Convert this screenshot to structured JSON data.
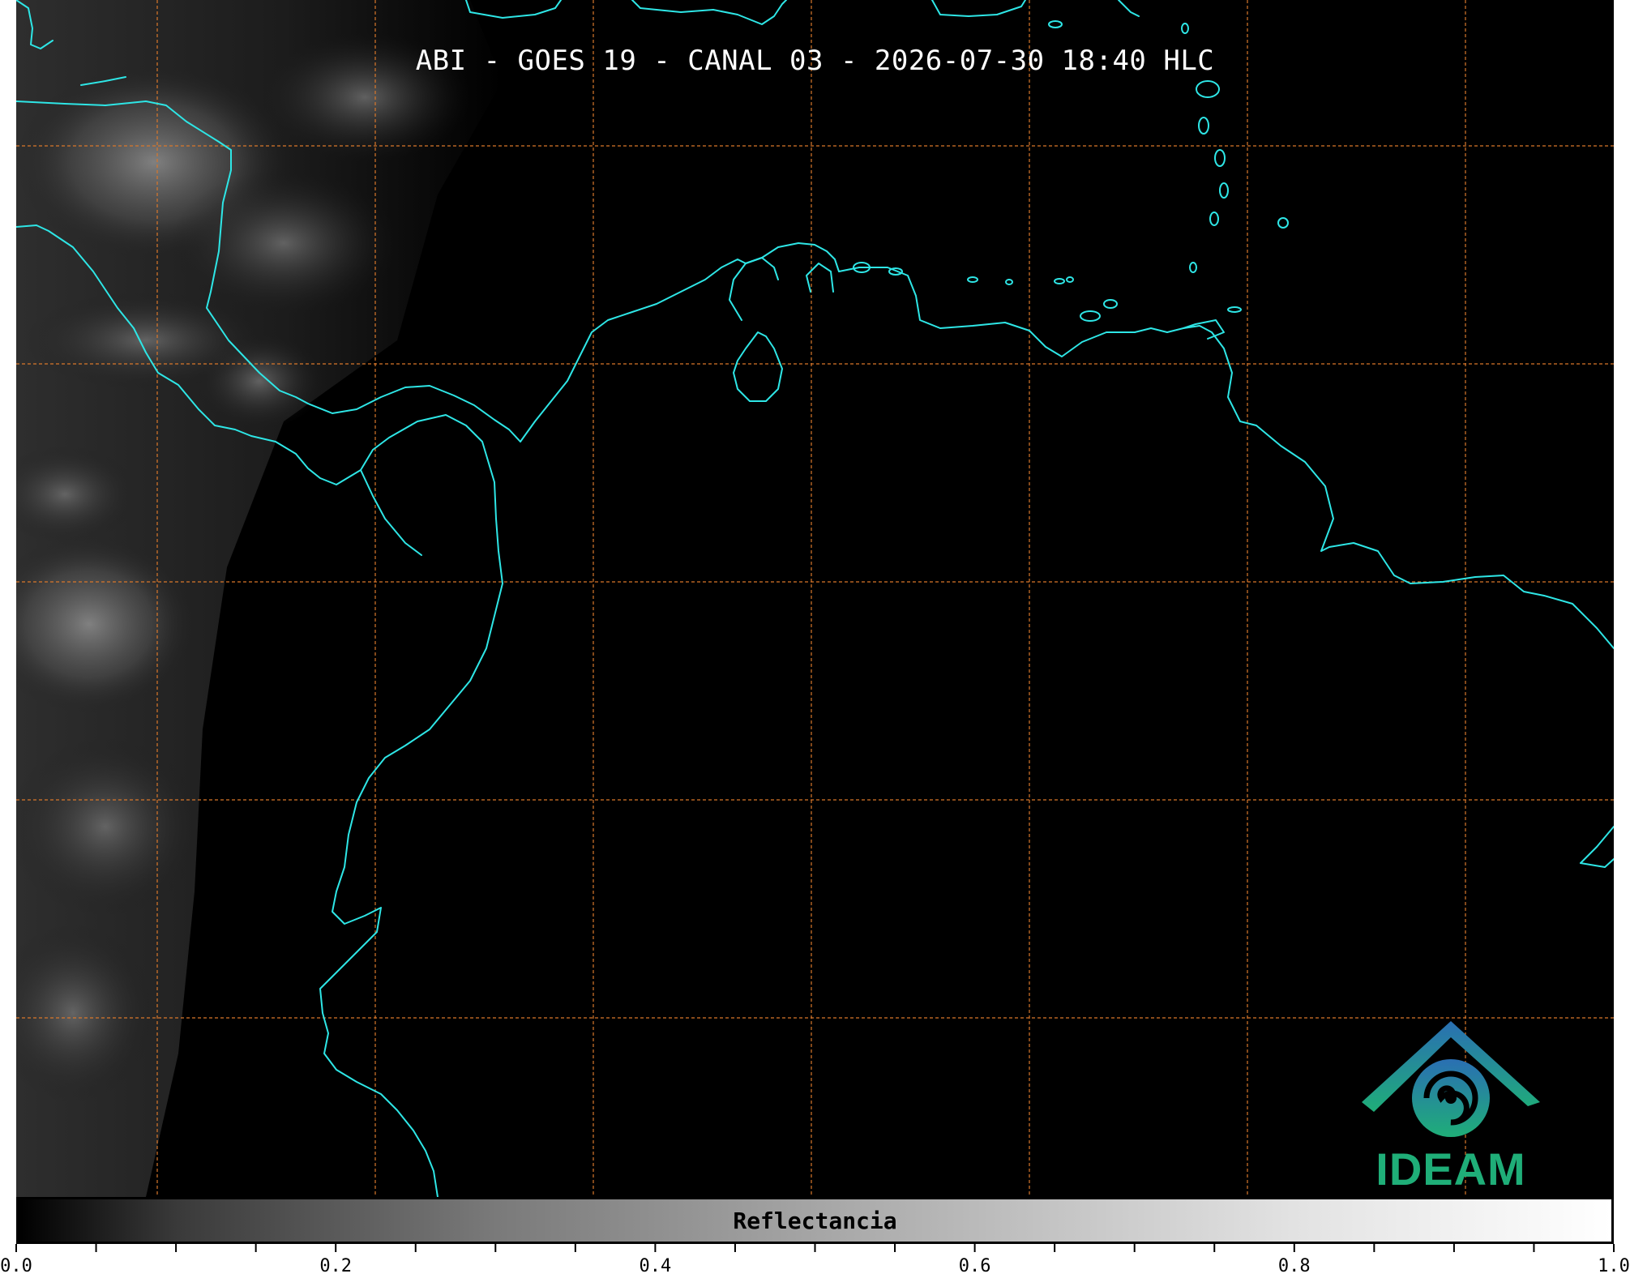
{
  "title": "ABI - GOES 19 - CANAL 03 - 2026-07-30 18:40 HLC",
  "logo": {
    "text": "IDEAM",
    "icon": "ideam-logo-icon"
  },
  "colorbar": {
    "label": "Reflectancia",
    "min": 0.0,
    "max": 1.0,
    "ticks": [
      "0.0",
      "0.2",
      "0.4",
      "0.6",
      "0.8",
      "1.0"
    ]
  },
  "map": {
    "grid": true,
    "grid_color": "#d9772b",
    "coastline_color": "#2ee6e6",
    "background_color": "#000000"
  }
}
